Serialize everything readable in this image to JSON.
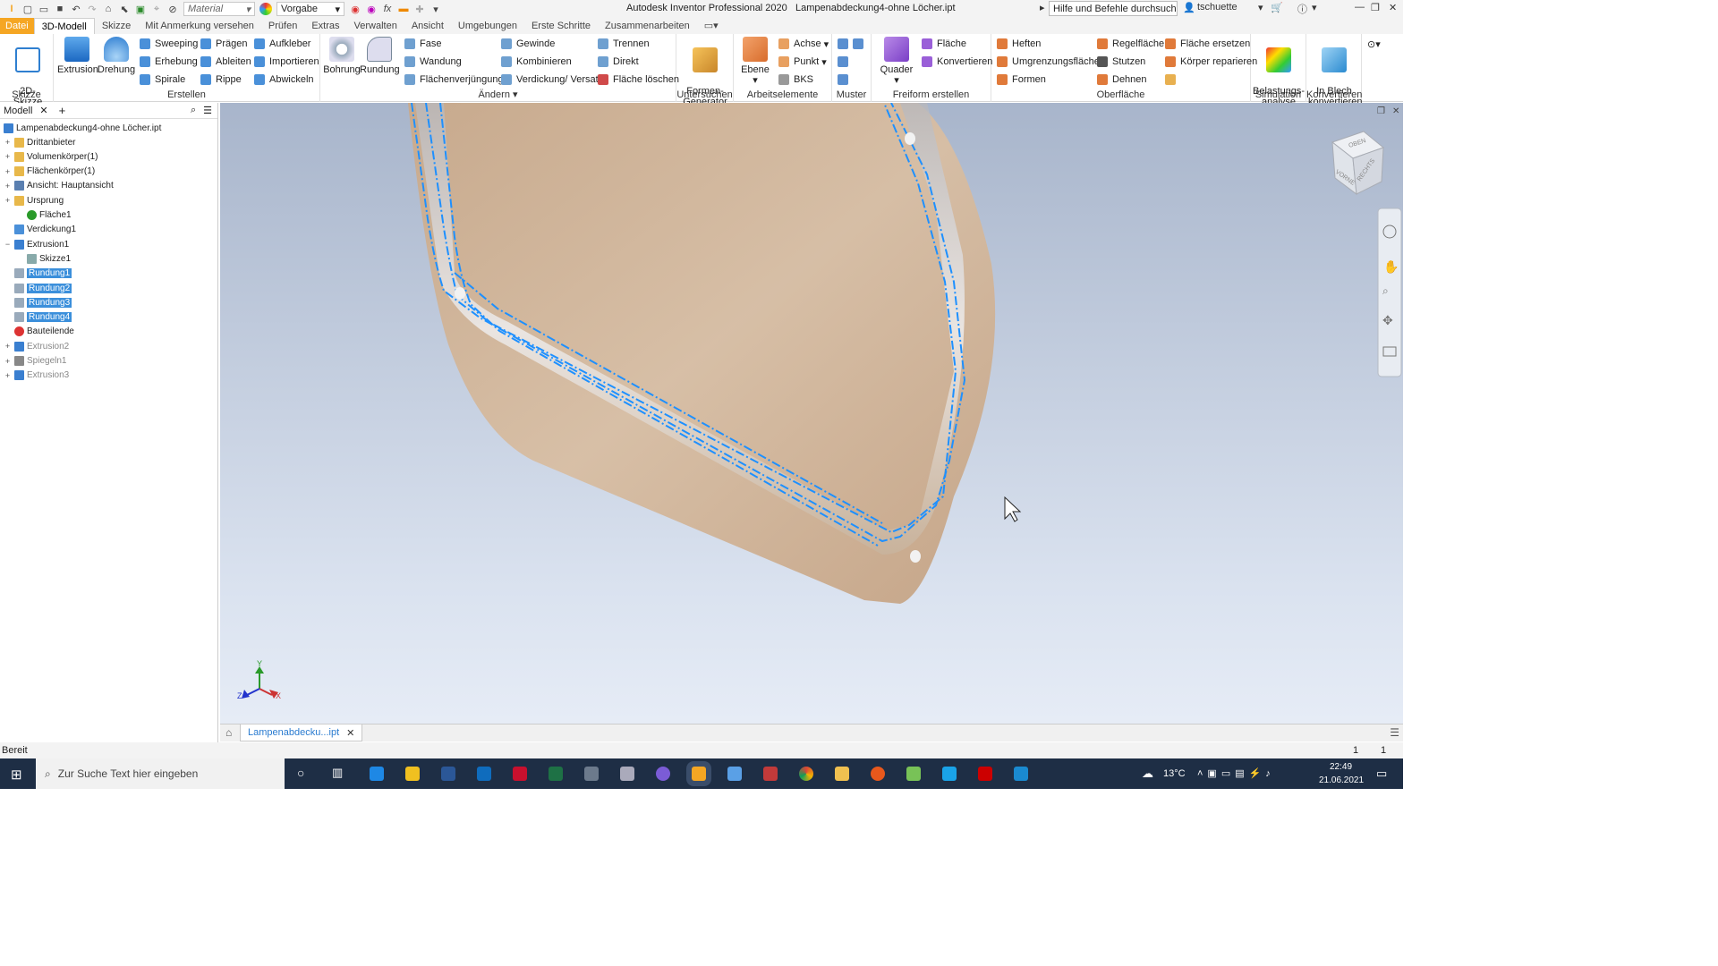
{
  "titlebar": {
    "material_placeholder": "Material",
    "appearance": "Vorgabe",
    "app_title": "Autodesk Inventor Professional 2020",
    "doc_title": "Lampenabdeckung4-ohne Löcher.ipt",
    "help_search": "Hilfe und Befehle durchsuchen...",
    "user": "tschuette"
  },
  "tabs": [
    "Datei",
    "3D-Modell",
    "Skizze",
    "Mit Anmerkung versehen",
    "Prüfen",
    "Extras",
    "Verwalten",
    "Ansicht",
    "Umgebungen",
    "Erste Schritte",
    "Zusammenarbeiten"
  ],
  "ribbon": {
    "skizze": {
      "label": "Skizze",
      "start": "2D-Skizze\nstarten"
    },
    "erstellen": {
      "label": "Erstellen",
      "extrusion": "Extrusion",
      "drehung": "Drehung",
      "col1": [
        "Sweeping",
        "Erhebung",
        "Spirale"
      ],
      "col2": [
        "Prägen",
        "Ableiten",
        "Rippe"
      ],
      "col3": [
        "Aufkleber",
        "Importieren",
        "Abwickeln"
      ]
    },
    "aendern": {
      "label": "Ändern",
      "bohrung": "Bohrung",
      "rundung": "Rundung",
      "col1": [
        "Fase",
        "Wandung",
        "Flächenverjüngung"
      ],
      "col2": [
        "Gewinde",
        "Kombinieren",
        "Verdickung/ Versatz"
      ],
      "col3": [
        "Trennen",
        "Direkt",
        "Fläche löschen"
      ]
    },
    "untersuchen": {
      "label": "Untersuchen",
      "formen": "Formen-\nGenerator"
    },
    "arbeitselemente": {
      "label": "Arbeitselemente",
      "ebene": "Ebene",
      "items": [
        "Achse",
        "Punkt",
        "BKS"
      ]
    },
    "muster": {
      "label": "Muster"
    },
    "freiform": {
      "label": "Freiform erstellen",
      "quader": "Quader",
      "items": [
        "Fläche",
        "Konvertieren"
      ]
    },
    "oberflaeche": {
      "label": "Oberfläche",
      "col1": [
        "Heften",
        "Umgrenzungsfläche",
        "Formen"
      ],
      "col2": [
        "Regelfläche",
        "Stutzen",
        "Dehnen"
      ],
      "col3": [
        "Fläche ersetzen",
        "Körper reparieren"
      ]
    },
    "simulation": {
      "label": "Simulation",
      "item": "Belastungs-\nanalyse"
    },
    "konvertieren": {
      "label": "Konvertieren",
      "item": "In Blech\nkonvertieren"
    }
  },
  "browser": {
    "tab": "Modell",
    "root": "Lampenabdeckung4-ohne Löcher.ipt",
    "items": [
      {
        "label": "Drittanbieter",
        "exp": "+",
        "indent": 0,
        "icon": "folder"
      },
      {
        "label": "Volumenkörper(1)",
        "exp": "+",
        "indent": 0,
        "icon": "folder"
      },
      {
        "label": "Flächenkörper(1)",
        "exp": "+",
        "indent": 0,
        "icon": "folder"
      },
      {
        "label": "Ansicht: Hauptansicht",
        "exp": "+",
        "indent": 0,
        "icon": "view"
      },
      {
        "label": "Ursprung",
        "exp": "+",
        "indent": 0,
        "icon": "folder"
      },
      {
        "label": "Fläche1",
        "exp": "",
        "indent": 1,
        "icon": "check"
      },
      {
        "label": "Verdickung1",
        "exp": "",
        "indent": 0,
        "icon": "feature"
      },
      {
        "label": "Extrusion1",
        "exp": "−",
        "indent": 0,
        "icon": "extrude"
      },
      {
        "label": "Skizze1",
        "exp": "",
        "indent": 1,
        "icon": "sketch"
      },
      {
        "label": "Rundung1",
        "exp": "",
        "indent": 0,
        "icon": "fillet",
        "selected": true
      },
      {
        "label": "Rundung2",
        "exp": "",
        "indent": 0,
        "icon": "fillet",
        "selected": true
      },
      {
        "label": "Rundung3",
        "exp": "",
        "indent": 0,
        "icon": "fillet",
        "selected": true
      },
      {
        "label": "Rundung4",
        "exp": "",
        "indent": 0,
        "icon": "fillet",
        "selected": true
      },
      {
        "label": "Bauteilende",
        "exp": "",
        "indent": 0,
        "icon": "end"
      },
      {
        "label": "Extrusion2",
        "exp": "+",
        "indent": 0,
        "icon": "extrude",
        "dim": true
      },
      {
        "label": "Spiegeln1",
        "exp": "+",
        "indent": 0,
        "icon": "mirror",
        "dim": true
      },
      {
        "label": "Extrusion3",
        "exp": "+",
        "indent": 0,
        "icon": "extrude",
        "dim": true
      }
    ]
  },
  "viewcube": {
    "top": "OBEN",
    "front": "VORNE",
    "right": "RECHTS"
  },
  "axes": {
    "x": "X",
    "y": "Y",
    "z": "Z"
  },
  "doctab": {
    "label": "Lampenabdecku...ipt"
  },
  "status": {
    "text": "Bereit",
    "num1": "1",
    "num2": "1"
  },
  "taskbar": {
    "search_placeholder": "Zur Suche Text hier eingeben",
    "temp": "13°C",
    "time": "22:49",
    "date": "21.06.2021"
  },
  "colors": {
    "accent_file": "#f5a623",
    "selection": "#3b8fdb",
    "part": "#d8b99a",
    "edge_highlight": "#1e90ff"
  }
}
